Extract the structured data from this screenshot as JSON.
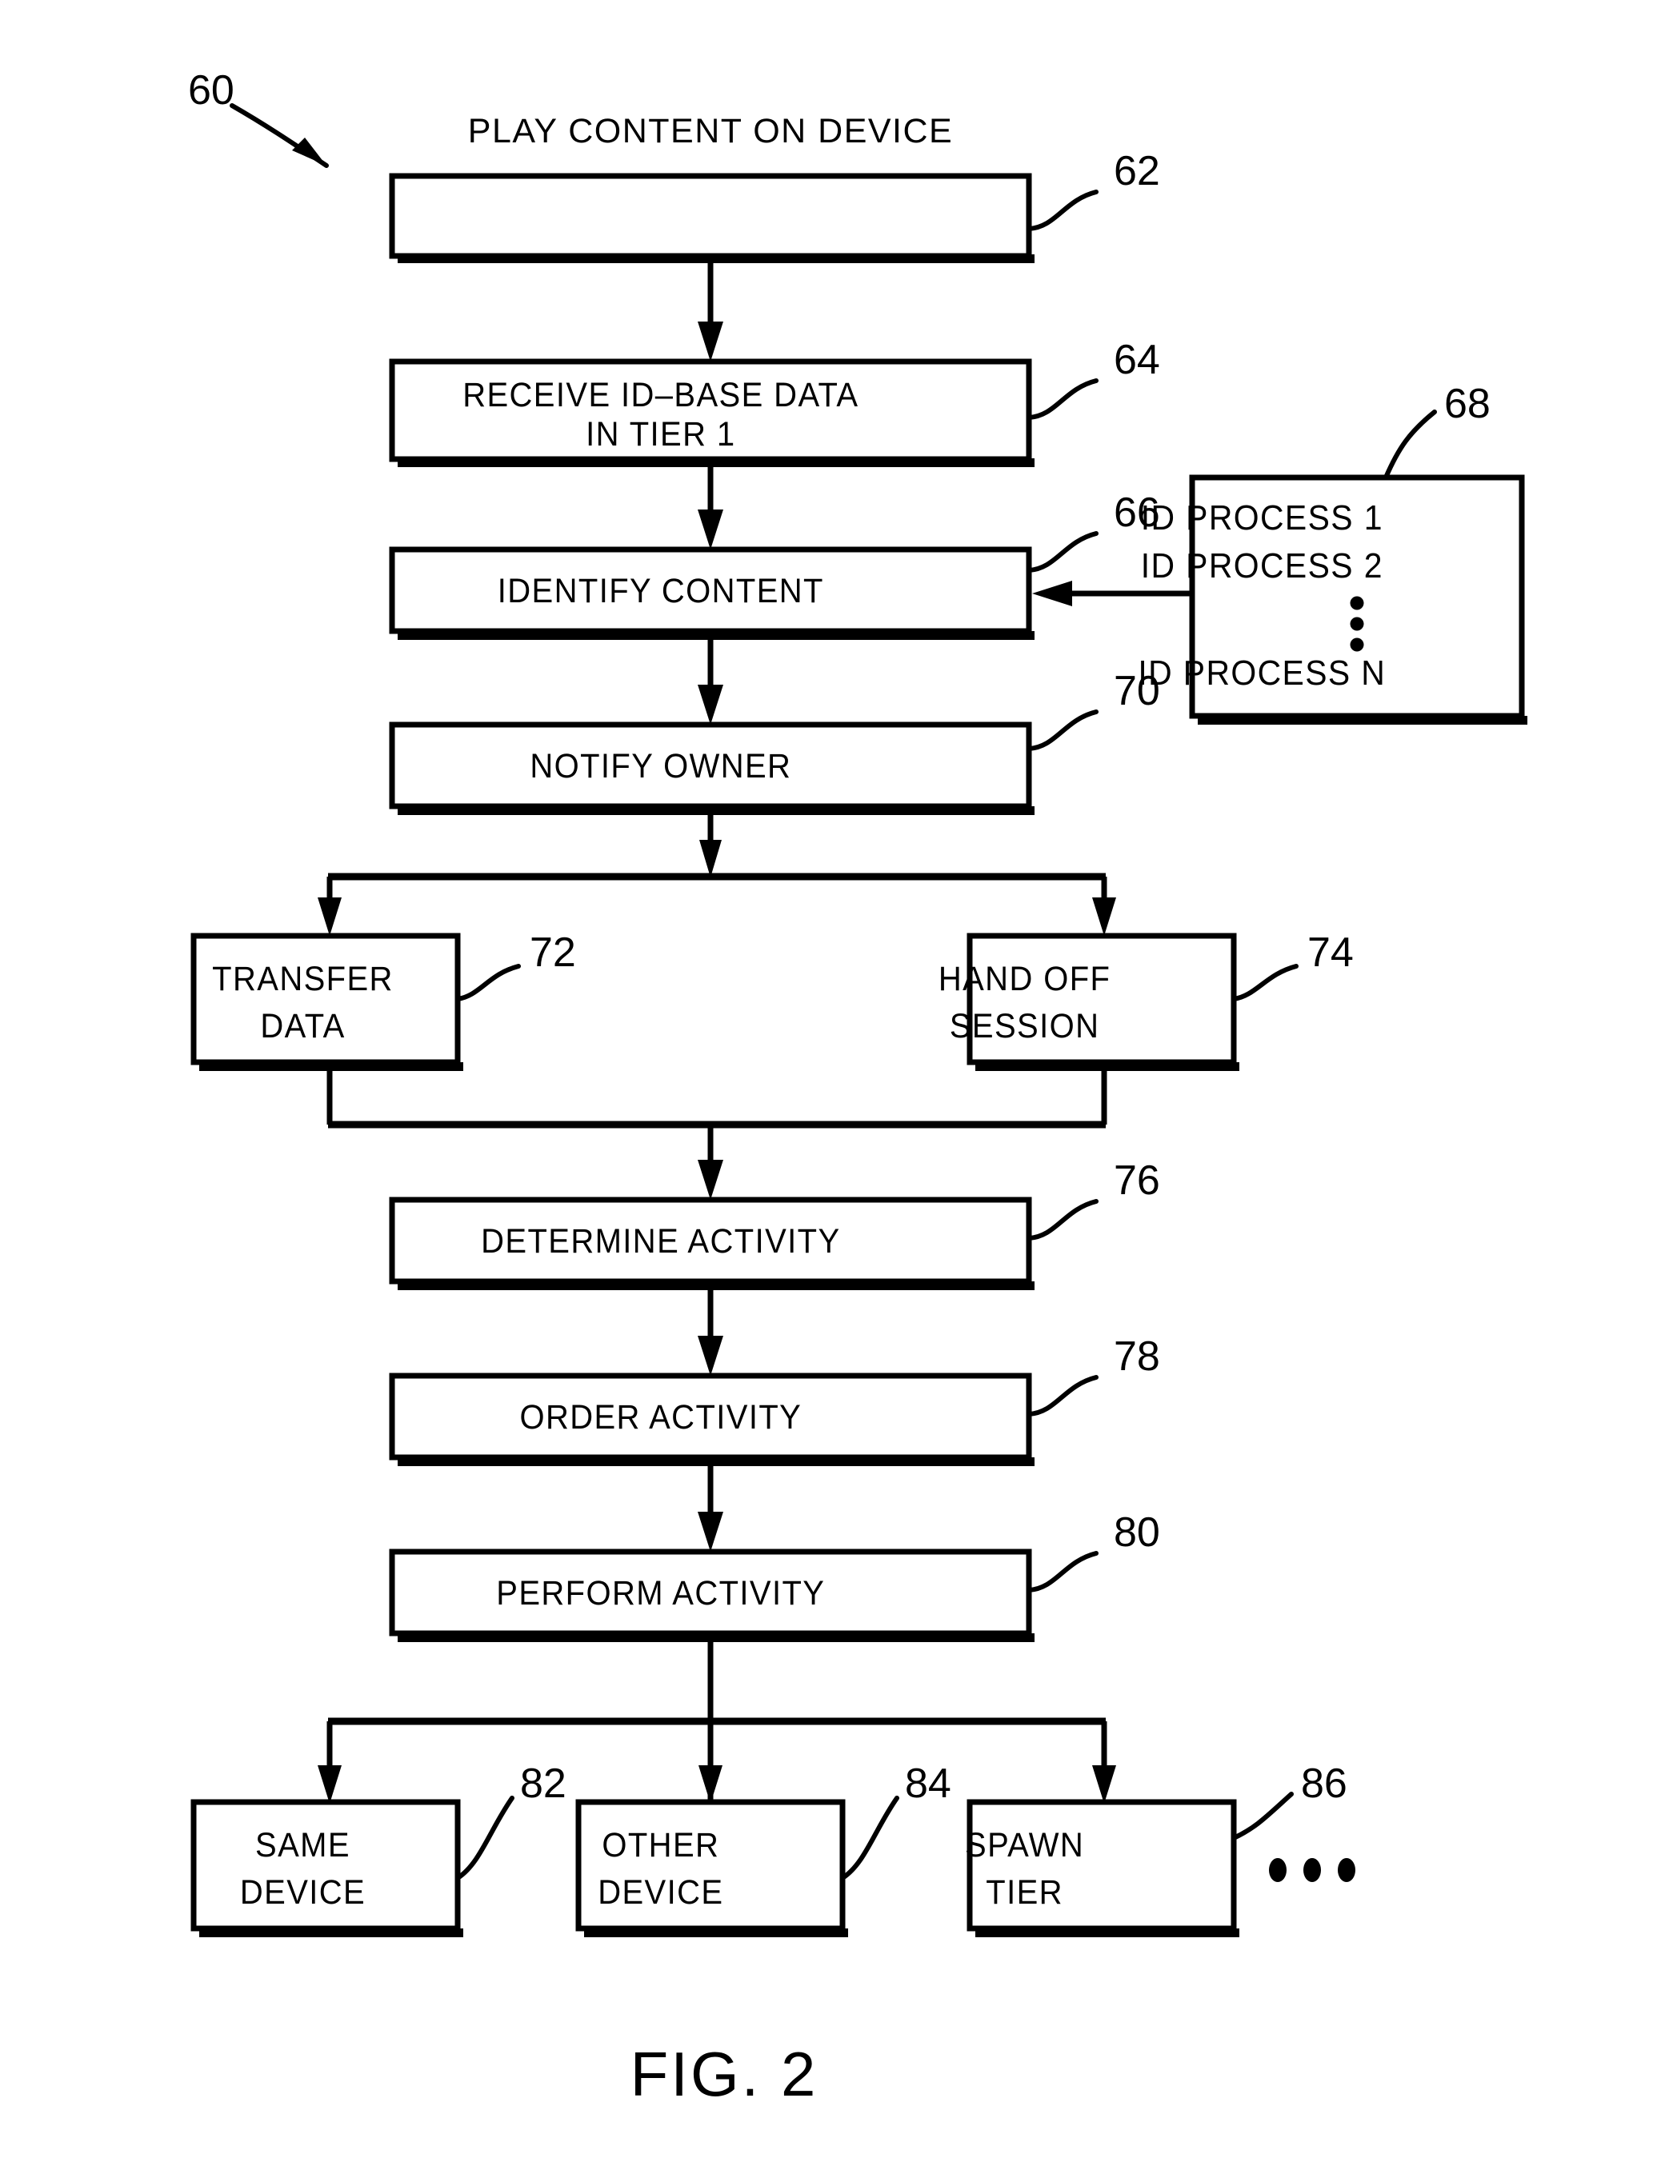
{
  "figure": {
    "caption": "FIG. 2",
    "main_ref": "60"
  },
  "nodes": {
    "play_content": {
      "label": "PLAY CONTENT ON  DEVICE",
      "ref": "62"
    },
    "receive_id_line1": {
      "label": "RECEIVE ID–BASE DATA"
    },
    "receive_id_line2": {
      "label": "IN  TIER 1",
      "ref": "64"
    },
    "identify_content": {
      "label": "IDENTIFY CONTENT",
      "ref": "66"
    },
    "notify_owner": {
      "label": "NOTIFY OWNER",
      "ref": "70"
    },
    "transfer_data_line1": {
      "label": "TRANSFER"
    },
    "transfer_data_line2": {
      "label": "DATA",
      "ref": "72"
    },
    "hand_off_line1": {
      "label": "HAND  OFF"
    },
    "hand_off_line2": {
      "label": "SESSION",
      "ref": "74"
    },
    "determine_activity": {
      "label": "DETERMINE  ACTIVITY",
      "ref": "76"
    },
    "order_activity": {
      "label": "ORDER  ACTIVITY",
      "ref": "78"
    },
    "perform_activity": {
      "label": "PERFORM  ACTIVITY",
      "ref": "80"
    },
    "same_device_line1": {
      "label": "SAME"
    },
    "same_device_line2": {
      "label": "DEVICE",
      "ref": "82"
    },
    "other_device_line1": {
      "label": "OTHER"
    },
    "other_device_line2": {
      "label": "DEVICE",
      "ref": "84"
    },
    "spawn_tier_line1": {
      "label": "SPAWN"
    },
    "spawn_tier_line2": {
      "label": "TIER",
      "ref": "86"
    }
  },
  "id_process_box": {
    "ref": "68",
    "items": [
      "ID  PROCESS 1",
      "ID  PROCESS 2",
      "ID  PROCESS N"
    ],
    "vertical_ellipsis": "⋮"
  },
  "colors": {
    "stroke": "#000000",
    "fill": "#ffffff",
    "background": "#ffffff"
  }
}
